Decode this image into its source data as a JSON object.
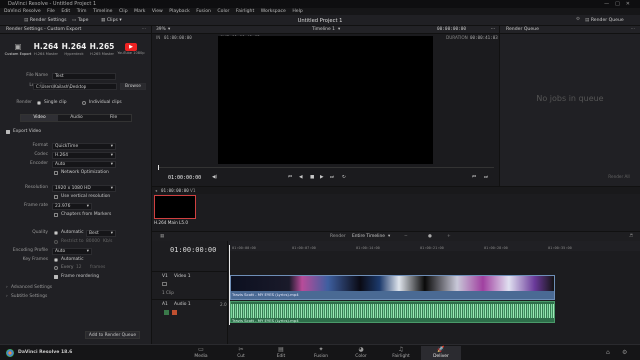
{
  "titlebar": {
    "title": "DaVinci Resolve - Untitled Project 1"
  },
  "menu": [
    "DaVinci Resolve",
    "File",
    "Edit",
    "Trim",
    "Timeline",
    "Clip",
    "Mark",
    "View",
    "Playback",
    "Fusion",
    "Color",
    "Fairlight",
    "Workspace",
    "Help"
  ],
  "toolbar": {
    "render_settings": "Render Settings",
    "tape": "Tape",
    "clips": "Clips",
    "project_title": "Untitled Project 1",
    "render_queue": "Render Queue"
  },
  "render": {
    "header": "Render Settings - Custom Export",
    "presets": [
      {
        "big": "",
        "label": "Custom Export"
      },
      {
        "big": "H.264",
        "label": "H.264 Master"
      },
      {
        "big": "H.264",
        "label": "Hyperdeck"
      },
      {
        "big": "H.265",
        "label": "H.265 Master"
      },
      {
        "big": "",
        "label": "YouTube 1080p"
      }
    ],
    "file_name_label": "File Name",
    "file_name": "Test",
    "location_label": "Location",
    "location": "C:\\Users\\Kailash\\Desktop",
    "browse": "Browse",
    "render_label": "Render",
    "single_clip": "Single clip",
    "individual_clips": "Individual clips",
    "tabs": [
      "Video",
      "Audio",
      "File"
    ],
    "export_video": "Export Video",
    "format_label": "Format",
    "format": "QuickTime",
    "codec_label": "Codec",
    "codec": "H.264",
    "encoder_label": "Encoder",
    "encoder": "Auto",
    "network_opt": "Network Optimization",
    "resolution_label": "Resolution",
    "resolution": "1920 x 1080 HD",
    "vertical_res": "Use vertical resolution",
    "frame_rate_label": "Frame rate",
    "frame_rate": "23.976",
    "chapters": "Chapters from Markers",
    "quality_label": "Quality",
    "quality_auto": "Automatic",
    "quality_val": "Best",
    "restrict_to": "Restrict to",
    "kbs": "80000",
    "kbs_unit": "Kb/s",
    "enc_profile_label": "Encoding Profile",
    "enc_profile": "Auto",
    "keyframes_label": "Key Frames",
    "kf_auto": "Automatic",
    "every": "Every",
    "every_val": "12",
    "frames": "frames",
    "frame_reorder": "Frame reordering",
    "advanced": "Advanced Settings",
    "subtitle": "Subtitle Settings",
    "add_queue": "Add to Render Queue"
  },
  "viewer": {
    "zoom": "39%",
    "in_tc": "01:00:00:00",
    "out_label": "OUT",
    "out_tc": "01:00:41:02",
    "timeline_name": "Timeline 1",
    "tc_right": "00:00:00:00",
    "duration_label": "DURATION",
    "duration": "00:00:41:03",
    "playhead_tc": "01:00:00:00"
  },
  "queue": {
    "header": "Render Queue",
    "empty": "No jobs in queue",
    "render_all": "Render All"
  },
  "timeline": {
    "clip_tc": "01:00:00:00",
    "clip_track": "V1",
    "thumb_label": "H.264 Main L5.0",
    "tc": "01:00:00:00",
    "render_label": "Render",
    "render_mode": "Entire Timeline",
    "ruler": [
      "01:00:00:00",
      "01:00:07:00",
      "01:00:14:00",
      "01:00:21:00",
      "01:00:28:00",
      "01:00:35:00"
    ],
    "v1": "V1",
    "video1": "Video 1",
    "v1_count": "1 Clip",
    "a1": "A1",
    "audio1": "Audio 1",
    "a1_ch": "2.0",
    "vclip": "Travis Scott - MY EYES (Lyrics).mp4",
    "aclip": "Travis Scott - MY EYES (Lyrics).mp4"
  },
  "pages": [
    "Media",
    "Cut",
    "Edit",
    "Fusion",
    "Color",
    "Fairlight",
    "Deliver"
  ],
  "app_name": "DaVinci Resolve 18.6"
}
